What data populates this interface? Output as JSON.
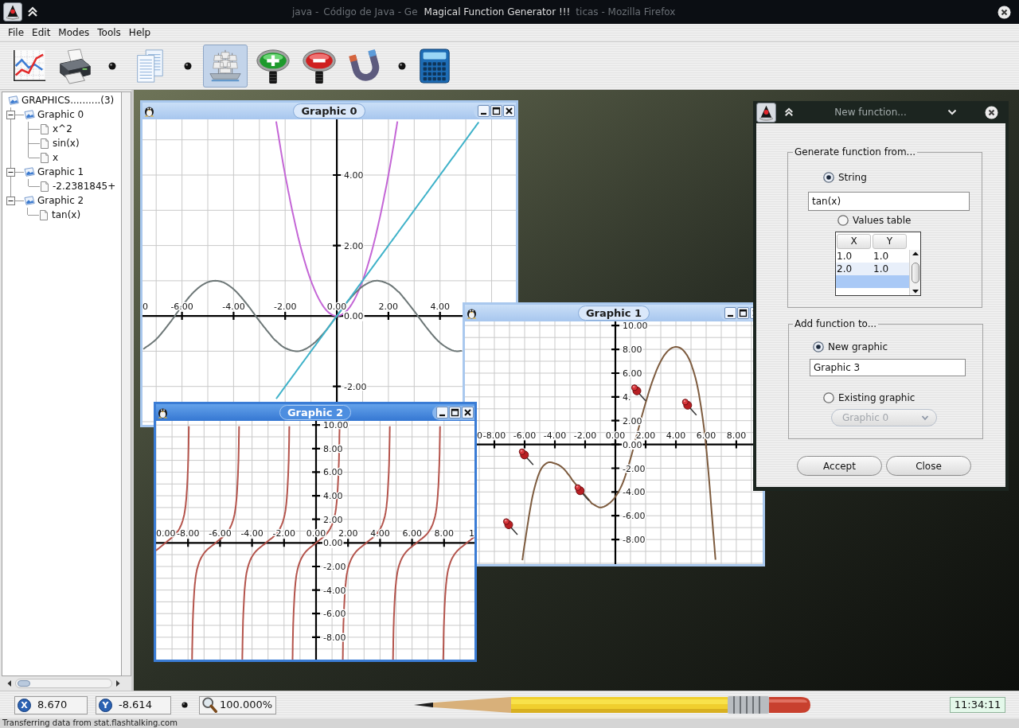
{
  "window": {
    "title": "Magical Function Generator !!!",
    "faded_texts_left": [
      "java -",
      "Código de Java - Ge"
    ],
    "faded_texts_right": [
      "ticas - Mozilla Firefox"
    ]
  },
  "menu": [
    "File",
    "Edit",
    "Modes",
    "Tools",
    "Help"
  ],
  "toolbar": [
    {
      "kind": "button",
      "selected": false
    },
    {
      "kind": "button",
      "selected": false
    },
    {
      "kind": "separator"
    },
    {
      "kind": "button",
      "selected": false
    },
    {
      "kind": "separator"
    },
    {
      "kind": "button",
      "selected": true
    },
    {
      "kind": "button",
      "selected": false
    },
    {
      "kind": "button",
      "selected": false
    },
    {
      "kind": "button",
      "selected": false
    },
    {
      "kind": "separator"
    },
    {
      "kind": "button",
      "selected": false
    }
  ],
  "tree": {
    "label": "GRAPHICS..........(3)",
    "children": [
      {
        "label": "Graphic 0",
        "expanded": true,
        "children": [
          {
            "label": "x^2"
          },
          {
            "label": "sin(x)"
          },
          {
            "label": "x"
          }
        ]
      },
      {
        "label": "Graphic 1",
        "expanded": true,
        "children": [
          {
            "label": "-2.2381845+"
          }
        ]
      },
      {
        "label": "Graphic 2",
        "expanded": true,
        "children": [
          {
            "label": "tan(x)"
          }
        ]
      }
    ]
  },
  "windows": [
    {
      "title": "Graphic 0",
      "active": false,
      "clipped_left_label": "0",
      "chart_data": {
        "type": "line",
        "grid": true,
        "x": [
          -7.5,
          -7,
          -6.5,
          -6,
          -5.5,
          -5,
          -4.5,
          -4,
          -3.5,
          -3,
          -2.5,
          -2.35,
          -2,
          -1.5,
          -1,
          -0.5,
          0,
          0.5,
          1,
          1.5,
          2,
          2.35,
          2.5,
          3,
          3.5,
          4,
          4.5,
          4.85,
          5,
          5.5
        ],
        "series": [
          {
            "color": "#c466d6",
            "values": [
              null,
              null,
              null,
              null,
              null,
              null,
              null,
              null,
              null,
              null,
              null,
              5.52,
              4,
              2.25,
              1,
              0.25,
              0,
              0.25,
              1,
              2.25,
              4,
              5.52,
              null,
              null,
              null,
              null,
              null,
              null,
              null,
              null
            ]
          },
          {
            "color": "#6c7676",
            "values": [
              -0.94,
              -0.66,
              -0.22,
              0.28,
              0.71,
              0.96,
              0.98,
              0.76,
              0.35,
              -0.14,
              -0.6,
              -0.71,
              -0.91,
              -1,
              -0.84,
              -0.48,
              0,
              0.48,
              0.84,
              1,
              0.91,
              0.71,
              0.6,
              0.14,
              -0.35,
              -0.76,
              -0.98,
              -0.99,
              null,
              null
            ]
          },
          {
            "color": "#3fb2c9",
            "values": [
              null,
              null,
              null,
              null,
              null,
              null,
              null,
              null,
              null,
              null,
              null,
              -2.35,
              -2,
              -1.5,
              -1,
              -0.5,
              0,
              0.5,
              1,
              1.5,
              2,
              2.35,
              2.5,
              3,
              3.5,
              4,
              4.5,
              4.85,
              5,
              5.5
            ]
          }
        ],
        "xlim": [
          -7.53,
          6.94
        ],
        "ylim": [
          -3.09,
          5.58
        ],
        "xticks": [
          {
            "value": -6,
            "label": "-6.00"
          },
          {
            "value": -4,
            "label": "-4.00"
          },
          {
            "value": -2,
            "label": "-2.00"
          },
          {
            "value": 0,
            "label": "0.00"
          },
          {
            "value": 2,
            "label": "2.00"
          },
          {
            "value": 4,
            "label": "4.00"
          }
        ],
        "yticks": [
          {
            "value": 4,
            "label": "4.00"
          },
          {
            "value": 2,
            "label": "2.00"
          },
          {
            "value": 0,
            "label": "0.00"
          },
          {
            "value": -2,
            "label": "-2.00"
          }
        ]
      }
    },
    {
      "title": "Graphic 1",
      "active": false,
      "clipped_left_label": "0",
      "chart_data": {
        "type": "line",
        "grid": true,
        "x": [
          -6.15,
          -6,
          -5.5,
          -5,
          -4.5,
          -4,
          -3.5,
          -3,
          -2.75,
          -1.65,
          -1.5,
          -1,
          -0.5,
          0,
          0.5,
          1,
          1.5,
          2,
          2.5,
          3,
          3.5,
          4,
          4.5,
          5,
          5.5,
          6,
          6.5,
          6.62
        ],
        "series": [
          {
            "color": "#7d5b3e",
            "values": [
              -9.75,
              -8.4,
              -4.5,
              -2.3,
              -1.55,
              -1.6,
              -1.95,
              -2.7,
              -3.15,
              -4.82,
              -5,
              -5.3,
              -5.05,
              -4.4,
              -3.2,
              -1.2,
              1.2,
              3.5,
              5.5,
              7,
              7.9,
              8.2,
              7.9,
              6.8,
              4.4,
              -0.2,
              -7.8,
              -9.7
            ]
          }
        ],
        "xlim": [
          -9.95,
          9.74
        ],
        "ylim": [
          -10.07,
          10.35
        ],
        "xticks": [
          {
            "value": -8,
            "label": "-8.00"
          },
          {
            "value": -6,
            "label": "-6.00"
          },
          {
            "value": -4,
            "label": "-4.00"
          },
          {
            "value": -2,
            "label": "-2.00"
          },
          {
            "value": 0,
            "label": "0.00"
          },
          {
            "value": 2,
            "label": "2.00"
          },
          {
            "value": 4,
            "label": "4.00"
          },
          {
            "value": 6,
            "label": "6.00"
          },
          {
            "value": 8,
            "label": "8.00"
          }
        ],
        "yticks": [
          {
            "value": 10,
            "label": "10.00"
          },
          {
            "value": 8,
            "label": "8.00"
          },
          {
            "value": 6,
            "label": "6.00"
          },
          {
            "value": 4,
            "label": "4."
          },
          {
            "value": 2,
            "label": "2.00"
          },
          {
            "value": 0,
            "label": "0.00"
          },
          {
            "value": -2,
            "label": "-2.00"
          },
          {
            "value": -4,
            "label": "-4.00"
          },
          {
            "value": -6,
            "label": "-6.00"
          },
          {
            "value": -8,
            "label": "-8.00"
          }
        ]
      }
    },
    {
      "title": "Graphic 2",
      "active": true,
      "clipped_left_label": "0.00",
      "clipped_right_label": "1",
      "chart_data": {
        "type": "line",
        "grid": true,
        "x": [
          -10,
          -9.42,
          -8.72,
          -8.32,
          -8.12,
          -8.0,
          -7.95,
          -7.85,
          -7.75,
          -7.7,
          -7.58,
          -7.38,
          -6.98,
          -6.28,
          -5.58,
          -5.18,
          -4.98,
          -4.86,
          -4.81,
          -4.71,
          -4.61,
          -4.56,
          -4.44,
          -4.24,
          -3.84,
          -3.14,
          -2.44,
          -2.04,
          -1.84,
          -1.72,
          -1.67,
          -1.57,
          -1.47,
          -1.42,
          -1.3,
          -1.1,
          -0.7,
          0,
          0.7,
          1.1,
          1.3,
          1.42,
          1.47,
          1.57,
          1.67,
          1.72,
          1.84,
          2.04,
          2.44,
          3.14,
          3.84,
          4.24,
          4.44,
          4.56,
          4.61,
          4.71,
          4.81,
          4.86,
          4.98,
          5.18,
          5.58,
          6.28,
          6.98,
          7.38,
          7.58,
          7.7,
          7.75,
          7.85,
          7.95,
          8.0,
          8.12,
          8.32,
          8.72,
          9.42,
          9.9
        ],
        "series": [
          {
            "color": "#b4544c",
            "values": [
              -0.65,
              0,
              0.84,
              1.96,
              3.6,
              6.58,
              9.89,
              null,
              -9.89,
              -6.58,
              -3.6,
              -1.96,
              -0.84,
              0,
              0.84,
              1.96,
              3.6,
              6.58,
              9.89,
              null,
              -9.89,
              -6.58,
              -3.6,
              -1.96,
              -0.84,
              0,
              0.84,
              1.96,
              3.6,
              6.58,
              9.89,
              null,
              -9.89,
              -6.58,
              -3.6,
              -1.96,
              -0.84,
              0,
              0.84,
              1.96,
              3.6,
              6.58,
              9.89,
              null,
              -9.89,
              -6.58,
              -3.6,
              -1.96,
              -0.84,
              0,
              0.84,
              1.96,
              3.6,
              6.58,
              9.89,
              null,
              -9.89,
              -6.58,
              -3.6,
              -1.96,
              -0.84,
              0,
              0.84,
              1.96,
              3.6,
              6.58,
              9.89,
              null,
              -9.89,
              -6.58,
              -3.6,
              -1.96,
              -0.84,
              0,
              0.51
            ]
          }
        ],
        "xlim": [
          -10,
          9.9
        ],
        "ylim": [
          -9.9,
          10.35
        ],
        "xticks": [
          {
            "value": -8,
            "label": "-8.00"
          },
          {
            "value": -6,
            "label": "-6.00"
          },
          {
            "value": -4,
            "label": "-4.00"
          },
          {
            "value": -2,
            "label": "-2.00"
          },
          {
            "value": 0,
            "label": "0.00"
          },
          {
            "value": 2,
            "label": "2.00"
          },
          {
            "value": 4,
            "label": "4.00"
          },
          {
            "value": 6,
            "label": "6.00"
          },
          {
            "value": 8,
            "label": "8.00"
          }
        ],
        "yticks": [
          {
            "value": 10,
            "label": "10.00"
          },
          {
            "value": 8,
            "label": "8.00"
          },
          {
            "value": 6,
            "label": "6.00"
          },
          {
            "value": 4,
            "label": "4.00"
          },
          {
            "value": 2,
            "label": "2.00"
          },
          {
            "value": 0,
            "label": "0.00"
          },
          {
            "value": -2,
            "label": "-2.00"
          },
          {
            "value": -4,
            "label": "-4.00"
          },
          {
            "value": -6,
            "label": "-6.00"
          },
          {
            "value": -8,
            "label": "-8.00"
          }
        ]
      }
    }
  ],
  "dialog": {
    "title": "New function...",
    "source": {
      "title": "Generate function from...",
      "options": [
        {
          "label": "String",
          "selected": true
        },
        {
          "label": "Values table",
          "selected": false
        }
      ],
      "expression": "tan(x)",
      "table": {
        "columns": [
          "X",
          "Y"
        ],
        "rows": [
          {
            "cells": [
              "1.0",
              "1.0"
            ],
            "selected": false
          },
          {
            "cells": [
              "2.0",
              "1.0"
            ],
            "selected": false
          },
          {
            "selected": true
          }
        ]
      }
    },
    "target": {
      "title": "Add function to...",
      "options": [
        {
          "label": "New graphic",
          "selected": true
        },
        {
          "label": "Existing graphic",
          "selected": false
        }
      ],
      "new_graphic_name": "Graphic 3",
      "existing_graphic": {
        "value": "Graphic 0",
        "disabled": true
      }
    },
    "buttons": [
      "Accept",
      "Close"
    ]
  },
  "status_bar": {
    "coordinates": [
      {
        "badge": "X",
        "value": "8.670"
      },
      {
        "badge": "Y",
        "value": "-8.614"
      }
    ],
    "zoom": "100.000%",
    "time": "11:34:11"
  },
  "browser_status": "Transferring data from stat.flashtalking.com"
}
